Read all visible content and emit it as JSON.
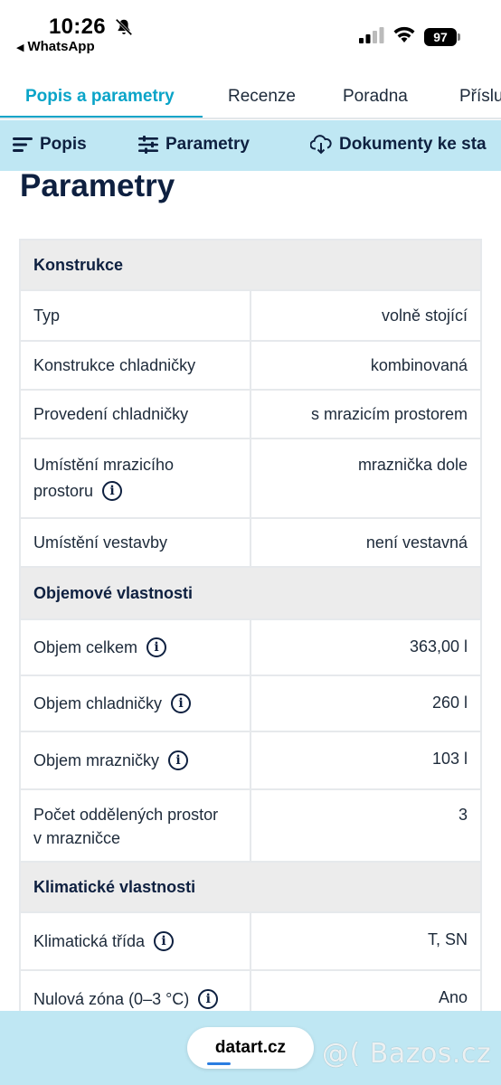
{
  "status_bar": {
    "time": "10:26",
    "back_app": "WhatsApp",
    "battery": "97"
  },
  "tabs": [
    {
      "label": "Popis a parametry",
      "active": true
    },
    {
      "label": "Recenze",
      "active": false
    },
    {
      "label": "Poradna",
      "active": false
    },
    {
      "label": "Příslu",
      "active": false
    }
  ],
  "subnav": [
    {
      "label": "Popis",
      "icon": "menu-lines-icon"
    },
    {
      "label": "Parametry",
      "icon": "sliders-icon"
    },
    {
      "label": "Dokumenty ke sta",
      "icon": "cloud-download-icon"
    }
  ],
  "page_title": "Parametry",
  "sections": [
    {
      "title": "Konstrukce",
      "rows": [
        {
          "name": "Typ",
          "value": "volně stojící"
        },
        {
          "name": "Konstrukce chladničky",
          "value": "kombinovaná"
        },
        {
          "name": "Provedení chladničky",
          "value": "s mrazicím prostorem"
        },
        {
          "name_line1": "Umístění mrazicího",
          "name_line2": "prostoru",
          "value": "mraznička dole",
          "info": true
        },
        {
          "name": "Umístění vestavby",
          "value": "není vestavná"
        }
      ]
    },
    {
      "title": "Objemové vlastnosti",
      "rows": [
        {
          "name": "Objem celkem",
          "value": "363,00 l",
          "info": true
        },
        {
          "name": "Objem chladničky",
          "value": "260 l",
          "info": true
        },
        {
          "name": "Objem mrazničky",
          "value": "103 l",
          "info": true
        },
        {
          "name_line1": "Počet oddělených prostor",
          "name_line2": "v mrazničce",
          "value": "3"
        }
      ]
    },
    {
      "title": "Klimatické vlastnosti",
      "rows": [
        {
          "name": "Klimatická třída",
          "value": "T, SN",
          "info": true
        },
        {
          "name": "Nulová zóna (0–3 °C)",
          "value": "Ano",
          "info": true
        }
      ]
    }
  ],
  "bottom_bar": {
    "url": "datart.cz",
    "watermark": "@( Bazos.cz"
  },
  "colors": {
    "accent": "#0aa4c8",
    "subnav_bg": "#bfe7f3",
    "heading": "#0e2040",
    "section_bg": "#ececec"
  }
}
